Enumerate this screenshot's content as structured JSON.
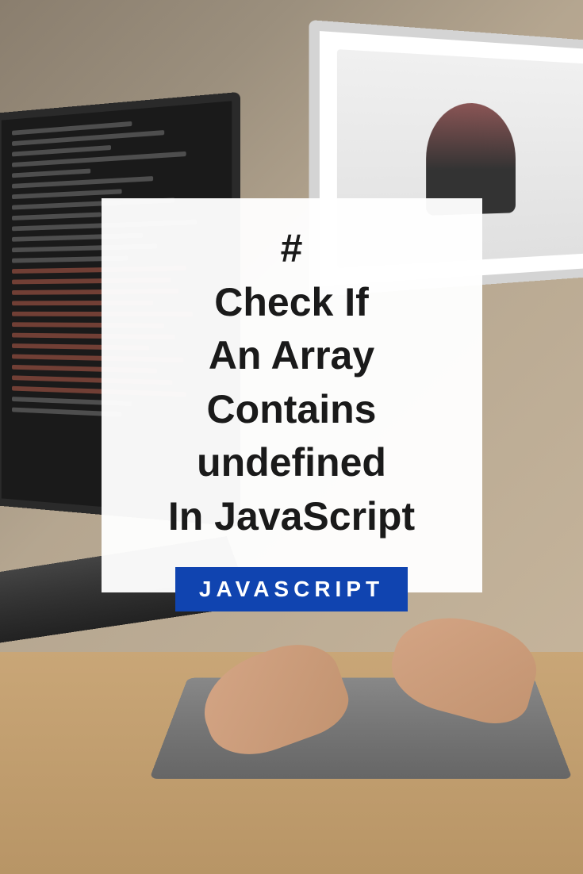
{
  "card": {
    "hash": "#",
    "title_line1": "Check If",
    "title_line2": "An Array",
    "title_line3": "Contains",
    "title_line4": "undefined",
    "title_line5": "In JavaScript",
    "badge": "JAVASCRIPT"
  }
}
